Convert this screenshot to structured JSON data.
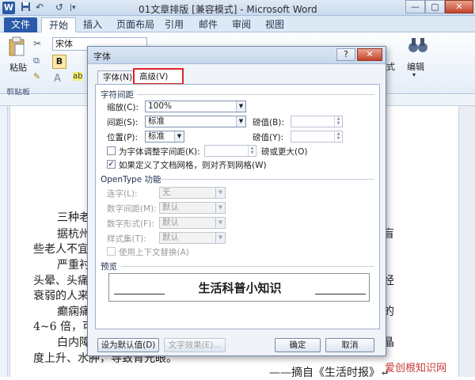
{
  "window": {
    "title": "01文章排版 [兼容模式] - Microsoft Word",
    "logo": "W"
  },
  "qat": {
    "save": "save-icon",
    "undo": "↶",
    "redo": "↺"
  },
  "ribbon": {
    "tabs": [
      "文件",
      "开始",
      "插入",
      "页面布局",
      "引用",
      "邮件",
      "审阅",
      "视图"
    ],
    "font_name": "宋体",
    "bold": "B",
    "paste": "粘贴",
    "clipboard": "剪贴板",
    "editing": "编辑",
    "styles_frag": "式"
  },
  "document": {
    "lines": [
      "三种老",
      "据杭州",
      "些老人不宜",
      "严重衬",
      "头晕、头痛",
      "衰弱的人来",
      "癫痫痛",
      "4~6 倍，可",
      "白内障",
      "度上升、水肿，导致青光眼。",
      "——摘自《生活时报》↵"
    ],
    "right_frag": [
      "盲",
      "经",
      "的",
      "晶"
    ]
  },
  "dialog": {
    "title": "字体",
    "help": "?",
    "close": "✕",
    "tabs": [
      {
        "label": "字体(N)"
      },
      {
        "label": "高级(V)"
      }
    ],
    "spacing": {
      "section": "字符间距",
      "scale_label": "缩放(C):",
      "scale_value": "100%",
      "spacing_label": "间距(S):",
      "spacing_value": "标准",
      "spacing_by_label": "磅值(B):",
      "position_label": "位置(P):",
      "position_value": "标准",
      "position_by_label": "磅值(Y):",
      "kerning_label": "为字体调整字间距(K):",
      "kerning_suffix": "磅或更大(O)",
      "grid_label": "如果定义了文档网格，则对齐到网格(W)"
    },
    "opentype": {
      "section": "OpenType 功能",
      "ligatures_label": "连字(L):",
      "ligatures_value": "无",
      "numspacing_label": "数字间距(M):",
      "numspacing_value": "默认",
      "numforms_label": "数字形式(F):",
      "numforms_value": "默认",
      "stylistic_label": "样式集(T):",
      "stylistic_value": "默认",
      "contextual_label": "使用上下文替换(A)"
    },
    "preview": {
      "section": "预览",
      "sample": "生活科普小知识"
    },
    "buttons": {
      "default": "设为默认值(D)",
      "effects": "文字效果(E)...",
      "ok": "确定",
      "cancel": "取消"
    }
  },
  "watermark": {
    "text": "爱创根知识网"
  }
}
